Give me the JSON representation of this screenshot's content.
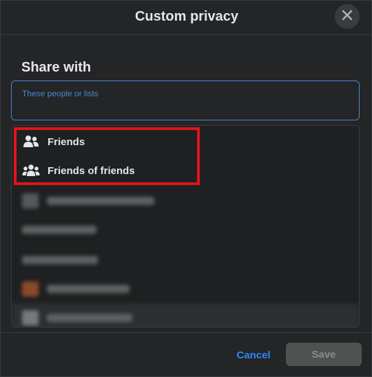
{
  "dialog": {
    "title": "Custom privacy",
    "close_icon": "close-icon"
  },
  "share_with": {
    "heading": "Share with",
    "search_placeholder": "These people or lists"
  },
  "options": [
    {
      "label": "Friends",
      "icon": "friends-icon"
    },
    {
      "label": "Friends of friends",
      "icon": "friends-of-friends-icon"
    }
  ],
  "footer": {
    "cancel_label": "Cancel",
    "save_label": "Save"
  },
  "colors": {
    "accent": "#2d88ff",
    "highlight": "#e0141b",
    "dialog_bg": "#242526"
  }
}
